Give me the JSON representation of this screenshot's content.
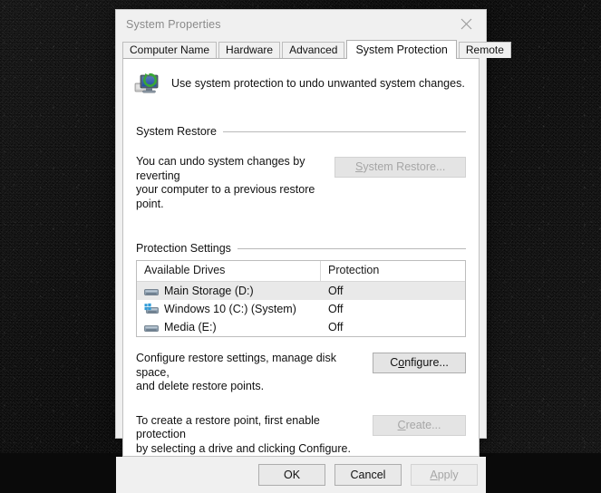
{
  "window": {
    "title": "System Properties",
    "close_label": "✕",
    "close_icon": "close-icon"
  },
  "tabs": [
    {
      "label": "Computer Name",
      "active": false
    },
    {
      "label": "Hardware",
      "active": false
    },
    {
      "label": "Advanced",
      "active": false
    },
    {
      "label": "System Protection",
      "active": true
    },
    {
      "label": "Remote",
      "active": false
    }
  ],
  "intro": {
    "icon": "system-protection-icon",
    "text": "Use system protection to undo unwanted system changes."
  },
  "system_restore": {
    "group_title": "System Restore",
    "description_line1": "You can undo system changes by reverting",
    "description_line2": "your computer to a previous restore point.",
    "button": {
      "label": "System Restore...",
      "mnemonic": "S",
      "label_rest": "ystem Restore...",
      "enabled": false
    }
  },
  "protection_settings": {
    "group_title": "Protection Settings",
    "columns": [
      "Available Drives",
      "Protection"
    ],
    "rows": [
      {
        "drive": "Main Storage (D:)",
        "protection": "Off",
        "icon": "hard-drive-icon",
        "selected": true
      },
      {
        "drive": "Windows 10 (C:) (System)",
        "protection": "Off",
        "icon": "system-drive-icon",
        "selected": false
      },
      {
        "drive": "Media (E:)",
        "protection": "Off",
        "icon": "hard-drive-icon",
        "selected": false
      }
    ],
    "configure": {
      "description_line1": "Configure restore settings, manage disk space,",
      "description_line2": "and delete restore points.",
      "button": {
        "label": "Configure...",
        "prefix": "C",
        "mnemonic": "o",
        "suffix": "nfigure...",
        "enabled": true
      }
    },
    "create": {
      "description_line1": "To create a restore point, first enable protection",
      "description_line2": "by selecting a drive and clicking Configure.",
      "button": {
        "label": "Create...",
        "mnemonic": "C",
        "label_rest": "reate...",
        "enabled": false
      }
    }
  },
  "footer": {
    "ok": "OK",
    "cancel": "Cancel",
    "apply": "Apply",
    "apply_mnemonic": "A",
    "apply_rest": "pply",
    "apply_enabled": false
  },
  "colors": {
    "dialog_bg": "#f0f0f0",
    "panel_bg": "#ffffff",
    "selection": "#e9e9e9",
    "text": "#111111",
    "disabled_text": "#a6a6a6",
    "title_text": "#8a8a8a",
    "desktop": "#0b0b0b"
  }
}
